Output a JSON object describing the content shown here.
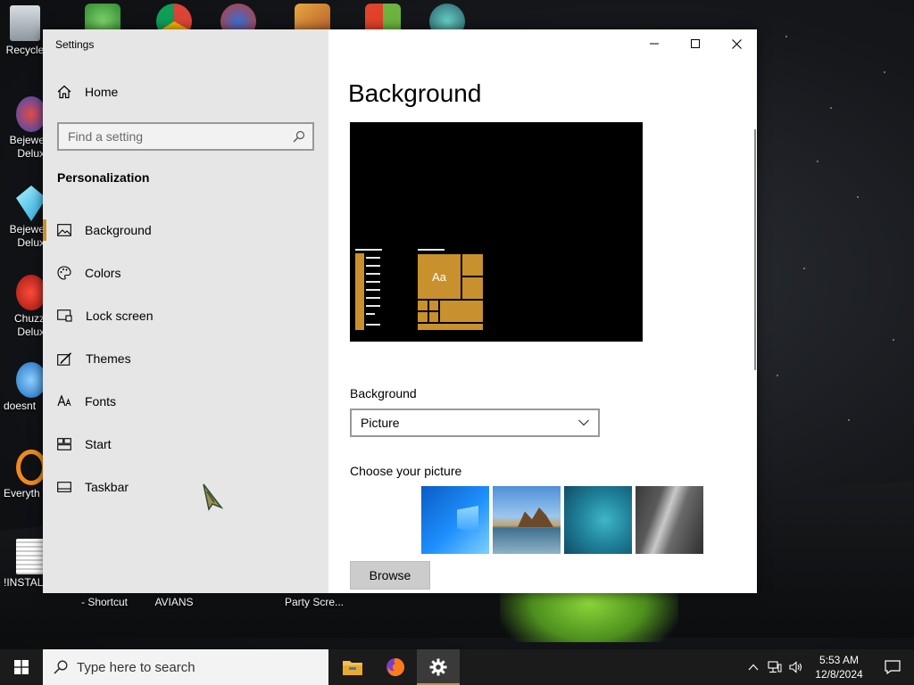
{
  "window": {
    "title": "Settings",
    "minimize_label": "—",
    "maximize_label": "☐",
    "close_label": "✕"
  },
  "sidebar": {
    "home_label": "Home",
    "search_placeholder": "Find a setting",
    "section_title": "Personalization",
    "items": [
      {
        "label": "Background",
        "icon": "picture-icon",
        "active": true
      },
      {
        "label": "Colors",
        "icon": "palette-icon"
      },
      {
        "label": "Lock screen",
        "icon": "lock-screen-icon"
      },
      {
        "label": "Themes",
        "icon": "brush-icon"
      },
      {
        "label": "Fonts",
        "icon": "font-icon"
      },
      {
        "label": "Start",
        "icon": "start-tiles-icon"
      },
      {
        "label": "Taskbar",
        "icon": "taskbar-icon"
      }
    ]
  },
  "main": {
    "title": "Background",
    "preview_tile_label": "Aa",
    "background_label": "Background",
    "background_value": "Picture",
    "choose_label": "Choose your picture",
    "browse_label": "Browse"
  },
  "desktop": {
    "top_labels": [
      "Recycle"
    ],
    "left_icons": [
      "Bejewe Delux",
      "Bejewe Delux",
      "Chuzz Delux",
      "doesnt",
      "Everyth",
      "!INSTALL"
    ],
    "bottom_labels": [
      "- Shortcut",
      "AVIANS",
      "Party Scre..."
    ]
  },
  "taskbar": {
    "search_placeholder": "Type here to search",
    "time": "5:53 AM",
    "date": "12/8/2024"
  },
  "colors": {
    "accent": "#c8912e"
  }
}
